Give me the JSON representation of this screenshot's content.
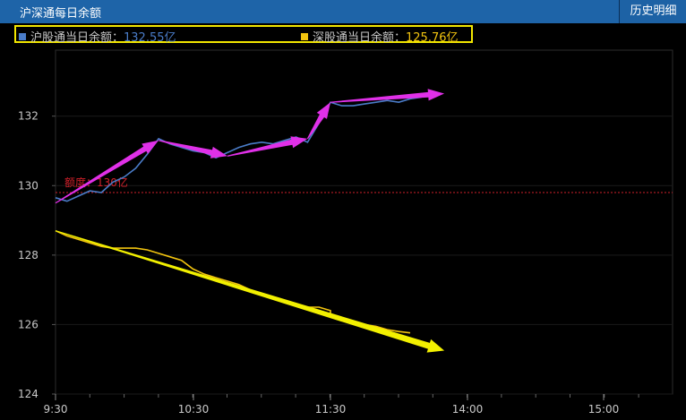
{
  "header": {
    "title": "沪深通每日余额",
    "history_button": "历史明细"
  },
  "legend": {
    "sh": {
      "label": "沪股通当日余额：",
      "value": "132.55亿",
      "color": "#4a7cc8"
    },
    "sz": {
      "label": "深股通当日余额：",
      "value": "125.76亿",
      "color": "#f2c40f"
    }
  },
  "colors": {
    "background": "#000000",
    "header_bg": "#1e64a8",
    "grid": "#2b2b2b",
    "quota_line": "#d0202a",
    "annotation_arrow_sh": "#e030e8",
    "annotation_arrow_sz": "#f2f000"
  },
  "chart_data": {
    "type": "line",
    "x_ticks": [
      "9:30",
      "10:30",
      "11:30",
      "14:00",
      "15:00"
    ],
    "y_ticks": [
      124,
      126,
      128,
      130,
      132
    ],
    "ylim": [
      124,
      133.9
    ],
    "grid": true,
    "quota": {
      "label": "额度：130亿",
      "value": 129.8
    },
    "series": [
      {
        "name": "沪股通当日余额",
        "color": "#4a7cc8",
        "points": [
          [
            "9:30",
            129.65
          ],
          [
            "9:35",
            129.55
          ],
          [
            "9:40",
            129.7
          ],
          [
            "9:45",
            129.85
          ],
          [
            "9:50",
            129.8
          ],
          [
            "9:55",
            130.1
          ],
          [
            "10:00",
            130.25
          ],
          [
            "10:05",
            130.5
          ],
          [
            "10:10",
            130.9
          ],
          [
            "10:15",
            131.35
          ],
          [
            "10:20",
            131.2
          ],
          [
            "10:25",
            131.1
          ],
          [
            "10:30",
            131.0
          ],
          [
            "10:35",
            130.95
          ],
          [
            "10:40",
            130.8
          ],
          [
            "10:45",
            130.95
          ],
          [
            "10:50",
            131.1
          ],
          [
            "10:55",
            131.2
          ],
          [
            "11:00",
            131.25
          ],
          [
            "11:05",
            131.2
          ],
          [
            "11:10",
            131.3
          ],
          [
            "11:15",
            131.4
          ],
          [
            "11:20",
            131.25
          ],
          [
            "11:25",
            131.8
          ],
          [
            "11:30",
            132.4
          ],
          [
            "13:00",
            132.4
          ],
          [
            "13:05",
            132.3
          ],
          [
            "13:10",
            132.3
          ],
          [
            "13:15",
            132.35
          ],
          [
            "13:20",
            132.4
          ],
          [
            "13:25",
            132.45
          ],
          [
            "13:30",
            132.4
          ],
          [
            "13:35",
            132.5
          ],
          [
            "13:40",
            132.55
          ]
        ]
      },
      {
        "name": "深股通当日余额",
        "color": "#f2c40f",
        "points": [
          [
            "9:30",
            128.7
          ],
          [
            "9:35",
            128.55
          ],
          [
            "9:40",
            128.45
          ],
          [
            "9:45",
            128.35
          ],
          [
            "9:50",
            128.25
          ],
          [
            "9:55",
            128.2
          ],
          [
            "10:00",
            128.2
          ],
          [
            "10:05",
            128.2
          ],
          [
            "10:10",
            128.15
          ],
          [
            "10:15",
            128.05
          ],
          [
            "10:20",
            127.95
          ],
          [
            "10:25",
            127.85
          ],
          [
            "10:30",
            127.6
          ],
          [
            "10:35",
            127.45
          ],
          [
            "10:40",
            127.35
          ],
          [
            "10:45",
            127.25
          ],
          [
            "10:50",
            127.15
          ],
          [
            "10:55",
            127.0
          ],
          [
            "11:00",
            126.85
          ],
          [
            "11:05",
            126.8
          ],
          [
            "11:10",
            126.7
          ],
          [
            "11:15",
            126.55
          ],
          [
            "11:20",
            126.5
          ],
          [
            "11:25",
            126.5
          ],
          [
            "11:30",
            126.4
          ],
          [
            "13:00",
            126.3
          ],
          [
            "13:05",
            126.2
          ],
          [
            "13:10",
            126.1
          ],
          [
            "13:15",
            126.0
          ],
          [
            "13:20",
            125.95
          ],
          [
            "13:25",
            125.85
          ],
          [
            "13:30",
            125.8
          ],
          [
            "13:35",
            125.76
          ]
        ]
      }
    ]
  },
  "annotations": {
    "sh_arrows": [
      [
        [
          "9:30",
          129.5
        ],
        [
          "10:15",
          131.3
        ]
      ],
      [
        [
          "10:15",
          131.3
        ],
        [
          "10:45",
          130.85
        ]
      ],
      [
        [
          "10:45",
          130.85
        ],
        [
          "11:20",
          131.35
        ]
      ],
      [
        [
          "11:20",
          131.35
        ],
        [
          "11:30",
          132.4
        ]
      ],
      [
        [
          "11:30",
          132.4
        ],
        [
          "13:50",
          132.65
        ]
      ]
    ],
    "sz_arrow": [
      [
        "9:30",
        128.7
      ],
      [
        "13:50",
        125.25
      ]
    ]
  }
}
